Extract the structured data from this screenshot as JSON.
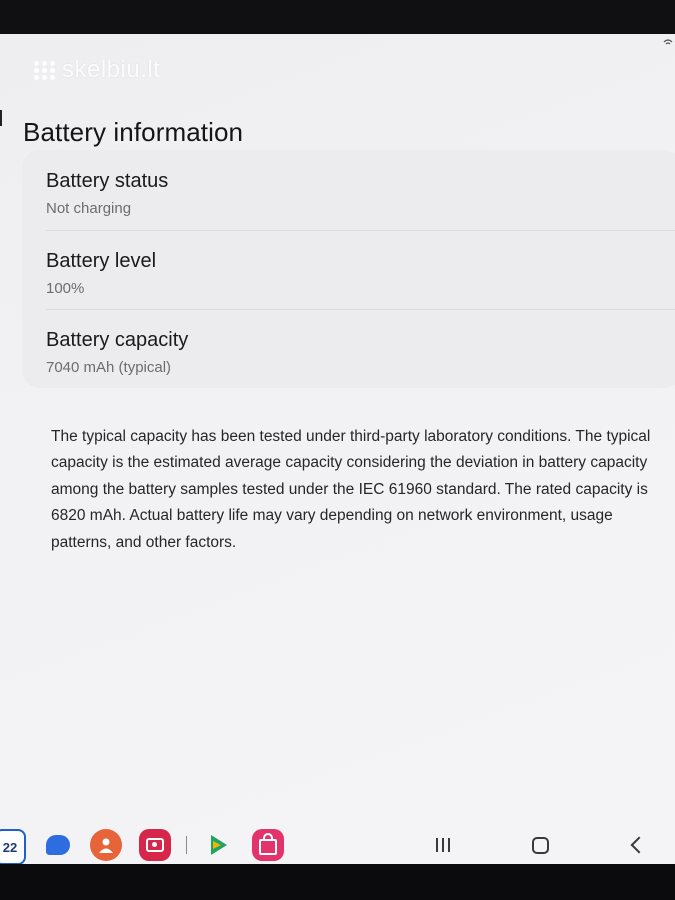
{
  "watermark": {
    "text": "skelbiu.lt"
  },
  "header": {
    "title": "Battery information"
  },
  "battery": {
    "items": [
      {
        "label": "Battery status",
        "value": "Not charging"
      },
      {
        "label": "Battery level",
        "value": "100%"
      },
      {
        "label": "Battery capacity",
        "value": "7040 mAh (typical)"
      }
    ],
    "description": "The typical capacity has been tested under third-party laboratory conditions. The typical capacity is the estimated average capacity considering the deviation in battery capacity among the battery samples tested under the IEC 61960 standard. The rated capacity is 6820 mAh. Actual battery life may vary depending on network environment, usage patterns, and other factors."
  },
  "taskbar": {
    "calendar_day": "22",
    "apps": [
      "calendar-icon",
      "messages-icon",
      "contacts-icon",
      "camera-icon",
      "play-store-icon",
      "galaxy-store-icon"
    ],
    "nav": [
      "recent-apps-icon",
      "home-icon",
      "back-icon"
    ]
  },
  "colors": {
    "screen_background": "#f2f2f4",
    "card_background": "#ececee",
    "title_text": "#151515",
    "secondary_text": "#6d6d6d",
    "camera_app": "#d6274b",
    "contacts_app": "#e7643a",
    "messages_app": "#2d6de0",
    "store_app": "#e2336b"
  }
}
